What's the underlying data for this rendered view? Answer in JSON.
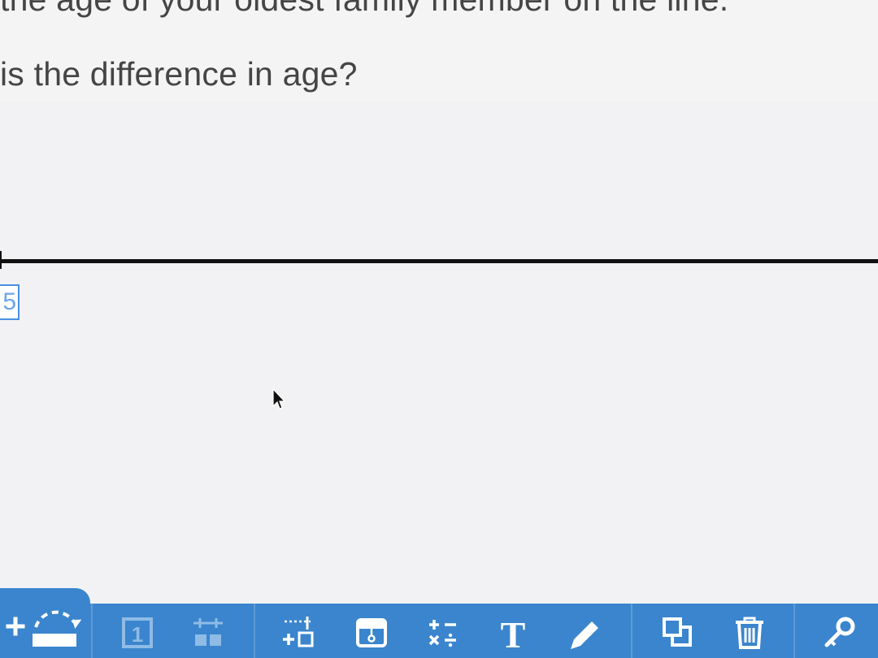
{
  "prompt": {
    "line1": "the age of your oldest family member on the line.",
    "line2": "is the difference in age?"
  },
  "number_box": {
    "value": "5"
  },
  "toolbar": {
    "tools": [
      {
        "name": "add-jump-tool",
        "icon": "add-arc-icon"
      },
      {
        "name": "number-tile-tool",
        "icon": "number-box-icon",
        "label": "1"
      },
      {
        "name": "tick-marks-tool",
        "icon": "tick-marks-icon"
      },
      {
        "name": "add-points-tool",
        "icon": "ruler-add-icon"
      },
      {
        "name": "hide-tool",
        "icon": "cover-icon"
      },
      {
        "name": "operations-tool",
        "icon": "operations-icon"
      },
      {
        "name": "text-tool",
        "icon": "text-icon",
        "label": "T"
      },
      {
        "name": "pencil-tool",
        "icon": "pencil-icon"
      },
      {
        "name": "duplicate-tool",
        "icon": "duplicate-icon"
      },
      {
        "name": "delete-tool",
        "icon": "trash-icon"
      },
      {
        "name": "key-tool",
        "icon": "key-icon"
      }
    ]
  },
  "colors": {
    "toolbar": "#3a85cd",
    "icon": "#ffffff",
    "icon_disabled": "#8fbbe6",
    "highlight": "#4a90e2"
  }
}
